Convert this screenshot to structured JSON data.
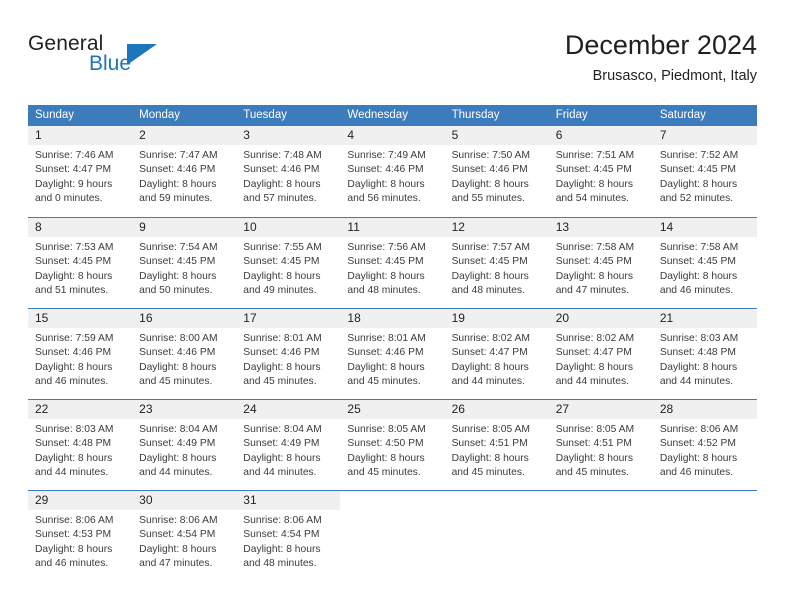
{
  "logo": {
    "word1": "General",
    "word2": "Blue",
    "icon": "triangle-logo-icon",
    "brand_color": "#1c76bc"
  },
  "header": {
    "title": "December 2024",
    "subtitle": "Brusasco, Piedmont, Italy"
  },
  "theme": {
    "header_blue": "#3c7cbd",
    "date_band_gray": "#f0f0f0",
    "text_color": "#231f20"
  },
  "weekdays": [
    "Sunday",
    "Monday",
    "Tuesday",
    "Wednesday",
    "Thursday",
    "Friday",
    "Saturday"
  ],
  "weeks": [
    [
      {
        "day": "1",
        "sunrise": "Sunrise: 7:46 AM",
        "sunset": "Sunset: 4:47 PM",
        "daylight1": "Daylight: 9 hours",
        "daylight2": "and 0 minutes."
      },
      {
        "day": "2",
        "sunrise": "Sunrise: 7:47 AM",
        "sunset": "Sunset: 4:46 PM",
        "daylight1": "Daylight: 8 hours",
        "daylight2": "and 59 minutes."
      },
      {
        "day": "3",
        "sunrise": "Sunrise: 7:48 AM",
        "sunset": "Sunset: 4:46 PM",
        "daylight1": "Daylight: 8 hours",
        "daylight2": "and 57 minutes."
      },
      {
        "day": "4",
        "sunrise": "Sunrise: 7:49 AM",
        "sunset": "Sunset: 4:46 PM",
        "daylight1": "Daylight: 8 hours",
        "daylight2": "and 56 minutes."
      },
      {
        "day": "5",
        "sunrise": "Sunrise: 7:50 AM",
        "sunset": "Sunset: 4:46 PM",
        "daylight1": "Daylight: 8 hours",
        "daylight2": "and 55 minutes."
      },
      {
        "day": "6",
        "sunrise": "Sunrise: 7:51 AM",
        "sunset": "Sunset: 4:45 PM",
        "daylight1": "Daylight: 8 hours",
        "daylight2": "and 54 minutes."
      },
      {
        "day": "7",
        "sunrise": "Sunrise: 7:52 AM",
        "sunset": "Sunset: 4:45 PM",
        "daylight1": "Daylight: 8 hours",
        "daylight2": "and 52 minutes."
      }
    ],
    [
      {
        "day": "8",
        "sunrise": "Sunrise: 7:53 AM",
        "sunset": "Sunset: 4:45 PM",
        "daylight1": "Daylight: 8 hours",
        "daylight2": "and 51 minutes."
      },
      {
        "day": "9",
        "sunrise": "Sunrise: 7:54 AM",
        "sunset": "Sunset: 4:45 PM",
        "daylight1": "Daylight: 8 hours",
        "daylight2": "and 50 minutes."
      },
      {
        "day": "10",
        "sunrise": "Sunrise: 7:55 AM",
        "sunset": "Sunset: 4:45 PM",
        "daylight1": "Daylight: 8 hours",
        "daylight2": "and 49 minutes."
      },
      {
        "day": "11",
        "sunrise": "Sunrise: 7:56 AM",
        "sunset": "Sunset: 4:45 PM",
        "daylight1": "Daylight: 8 hours",
        "daylight2": "and 48 minutes."
      },
      {
        "day": "12",
        "sunrise": "Sunrise: 7:57 AM",
        "sunset": "Sunset: 4:45 PM",
        "daylight1": "Daylight: 8 hours",
        "daylight2": "and 48 minutes."
      },
      {
        "day": "13",
        "sunrise": "Sunrise: 7:58 AM",
        "sunset": "Sunset: 4:45 PM",
        "daylight1": "Daylight: 8 hours",
        "daylight2": "and 47 minutes."
      },
      {
        "day": "14",
        "sunrise": "Sunrise: 7:58 AM",
        "sunset": "Sunset: 4:45 PM",
        "daylight1": "Daylight: 8 hours",
        "daylight2": "and 46 minutes."
      }
    ],
    [
      {
        "day": "15",
        "sunrise": "Sunrise: 7:59 AM",
        "sunset": "Sunset: 4:46 PM",
        "daylight1": "Daylight: 8 hours",
        "daylight2": "and 46 minutes."
      },
      {
        "day": "16",
        "sunrise": "Sunrise: 8:00 AM",
        "sunset": "Sunset: 4:46 PM",
        "daylight1": "Daylight: 8 hours",
        "daylight2": "and 45 minutes."
      },
      {
        "day": "17",
        "sunrise": "Sunrise: 8:01 AM",
        "sunset": "Sunset: 4:46 PM",
        "daylight1": "Daylight: 8 hours",
        "daylight2": "and 45 minutes."
      },
      {
        "day": "18",
        "sunrise": "Sunrise: 8:01 AM",
        "sunset": "Sunset: 4:46 PM",
        "daylight1": "Daylight: 8 hours",
        "daylight2": "and 45 minutes."
      },
      {
        "day": "19",
        "sunrise": "Sunrise: 8:02 AM",
        "sunset": "Sunset: 4:47 PM",
        "daylight1": "Daylight: 8 hours",
        "daylight2": "and 44 minutes."
      },
      {
        "day": "20",
        "sunrise": "Sunrise: 8:02 AM",
        "sunset": "Sunset: 4:47 PM",
        "daylight1": "Daylight: 8 hours",
        "daylight2": "and 44 minutes."
      },
      {
        "day": "21",
        "sunrise": "Sunrise: 8:03 AM",
        "sunset": "Sunset: 4:48 PM",
        "daylight1": "Daylight: 8 hours",
        "daylight2": "and 44 minutes."
      }
    ],
    [
      {
        "day": "22",
        "sunrise": "Sunrise: 8:03 AM",
        "sunset": "Sunset: 4:48 PM",
        "daylight1": "Daylight: 8 hours",
        "daylight2": "and 44 minutes."
      },
      {
        "day": "23",
        "sunrise": "Sunrise: 8:04 AM",
        "sunset": "Sunset: 4:49 PM",
        "daylight1": "Daylight: 8 hours",
        "daylight2": "and 44 minutes."
      },
      {
        "day": "24",
        "sunrise": "Sunrise: 8:04 AM",
        "sunset": "Sunset: 4:49 PM",
        "daylight1": "Daylight: 8 hours",
        "daylight2": "and 44 minutes."
      },
      {
        "day": "25",
        "sunrise": "Sunrise: 8:05 AM",
        "sunset": "Sunset: 4:50 PM",
        "daylight1": "Daylight: 8 hours",
        "daylight2": "and 45 minutes."
      },
      {
        "day": "26",
        "sunrise": "Sunrise: 8:05 AM",
        "sunset": "Sunset: 4:51 PM",
        "daylight1": "Daylight: 8 hours",
        "daylight2": "and 45 minutes."
      },
      {
        "day": "27",
        "sunrise": "Sunrise: 8:05 AM",
        "sunset": "Sunset: 4:51 PM",
        "daylight1": "Daylight: 8 hours",
        "daylight2": "and 45 minutes."
      },
      {
        "day": "28",
        "sunrise": "Sunrise: 8:06 AM",
        "sunset": "Sunset: 4:52 PM",
        "daylight1": "Daylight: 8 hours",
        "daylight2": "and 46 minutes."
      }
    ],
    [
      {
        "day": "29",
        "sunrise": "Sunrise: 8:06 AM",
        "sunset": "Sunset: 4:53 PM",
        "daylight1": "Daylight: 8 hours",
        "daylight2": "and 46 minutes."
      },
      {
        "day": "30",
        "sunrise": "Sunrise: 8:06 AM",
        "sunset": "Sunset: 4:54 PM",
        "daylight1": "Daylight: 8 hours",
        "daylight2": "and 47 minutes."
      },
      {
        "day": "31",
        "sunrise": "Sunrise: 8:06 AM",
        "sunset": "Sunset: 4:54 PM",
        "daylight1": "Daylight: 8 hours",
        "daylight2": "and 48 minutes."
      },
      {
        "day": "",
        "sunrise": "",
        "sunset": "",
        "daylight1": "",
        "daylight2": ""
      },
      {
        "day": "",
        "sunrise": "",
        "sunset": "",
        "daylight1": "",
        "daylight2": ""
      },
      {
        "day": "",
        "sunrise": "",
        "sunset": "",
        "daylight1": "",
        "daylight2": ""
      },
      {
        "day": "",
        "sunrise": "",
        "sunset": "",
        "daylight1": "",
        "daylight2": ""
      }
    ]
  ]
}
